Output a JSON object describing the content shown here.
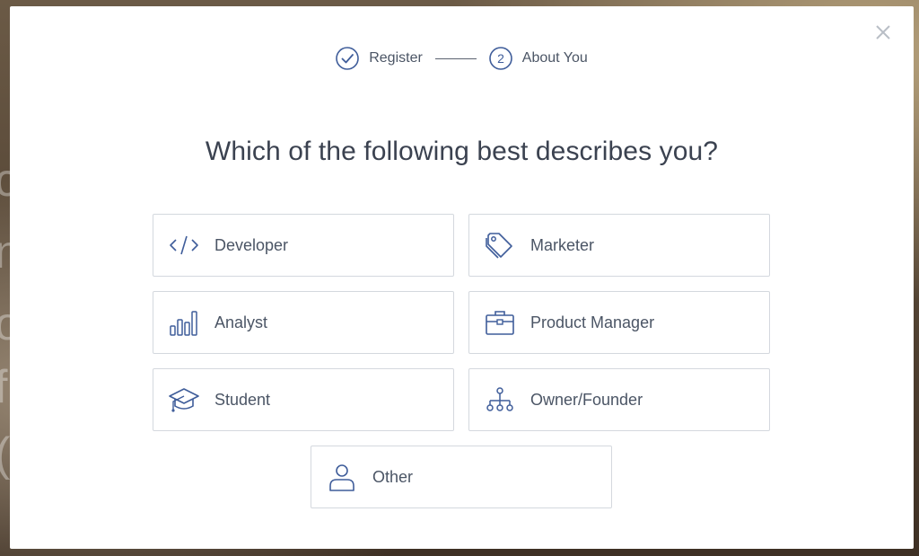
{
  "stepper": {
    "steps": [
      {
        "label": "Register",
        "state": "done",
        "icon": "check-circle-icon"
      },
      {
        "label": "About You",
        "state": "active",
        "number": "2"
      }
    ]
  },
  "question": "Which of the following best describes you?",
  "options": [
    {
      "label": "Developer",
      "icon": "code-icon"
    },
    {
      "label": "Marketer",
      "icon": "tag-icon"
    },
    {
      "label": "Analyst",
      "icon": "bar-chart-icon"
    },
    {
      "label": "Product Manager",
      "icon": "briefcase-icon"
    },
    {
      "label": "Student",
      "icon": "graduation-cap-icon"
    },
    {
      "label": "Owner/Founder",
      "icon": "org-chart-icon"
    },
    {
      "label": "Other",
      "icon": "person-icon"
    }
  ],
  "colors": {
    "accent": "#3f5d9a",
    "text": "#4b5565",
    "border": "#d4d8de"
  }
}
